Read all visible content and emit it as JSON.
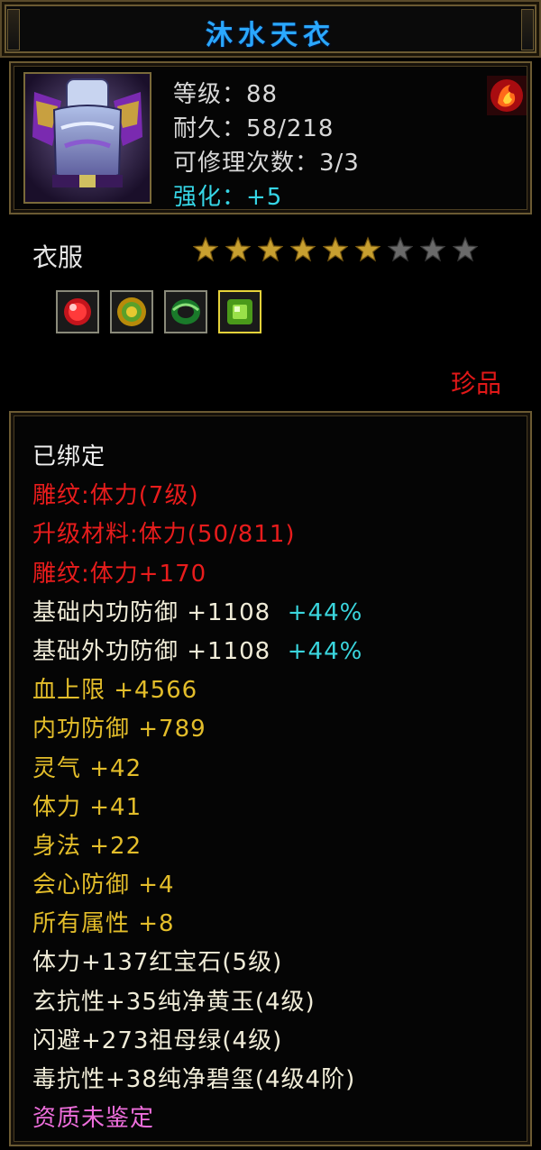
{
  "item": {
    "name": "沐水天衣",
    "level": "等级：88",
    "durability": "耐久：58/218",
    "repair_count": "可修理次数：3/3",
    "enhance": "强化：+5",
    "type": "衣服",
    "rarity": "珍品",
    "stars_total": 9,
    "stars_filled": 6
  },
  "gems": [
    {
      "name": "red-gem-icon",
      "color": "#d81818"
    },
    {
      "name": "yellow-jade-icon",
      "color": "#c9a416"
    },
    {
      "name": "green-jade-icon",
      "color": "#2e9a3a"
    },
    {
      "name": "emerald-icon",
      "color": "#7fd23a"
    }
  ],
  "attributes": [
    {
      "text": "已绑定",
      "extra": "",
      "color": "white"
    },
    {
      "text": "雕纹:体力(7级)",
      "extra": "",
      "color": "red"
    },
    {
      "text": "升级材料:体力(50/811)",
      "extra": "",
      "color": "red"
    },
    {
      "text": "雕纹:体力+170",
      "extra": "",
      "color": "red"
    },
    {
      "text": "基础内功防御 +1108 ",
      "extra": "+44%",
      "color": "light"
    },
    {
      "text": "基础外功防御 +1108 ",
      "extra": "+44%",
      "color": "light"
    },
    {
      "text": "血上限 +4566",
      "extra": "",
      "color": "gold"
    },
    {
      "text": "内功防御 +789",
      "extra": "",
      "color": "gold"
    },
    {
      "text": "灵气 +42",
      "extra": "",
      "color": "gold"
    },
    {
      "text": "体力 +41",
      "extra": "",
      "color": "gold"
    },
    {
      "text": "身法 +22",
      "extra": "",
      "color": "gold"
    },
    {
      "text": "会心防御 +4",
      "extra": "",
      "color": "gold"
    },
    {
      "text": "所有属性 +8",
      "extra": "",
      "color": "gold"
    },
    {
      "text": "体力+137红宝石(5级)",
      "extra": "",
      "color": "light"
    },
    {
      "text": "玄抗性+35纯净黄玉(4级)",
      "extra": "",
      "color": "light"
    },
    {
      "text": "闪避+273祖母绿(4级)",
      "extra": "",
      "color": "light"
    },
    {
      "text": "毒抗性+38纯净碧玺(4级4阶)",
      "extra": "",
      "color": "light"
    },
    {
      "text": "资质未鉴定",
      "extra": "",
      "color": "pink"
    }
  ],
  "colors": {
    "title": "#2aa8ff",
    "star_filled": "#c8a030",
    "star_empty": "#6a6a6a",
    "frame": "#6b5a32"
  }
}
